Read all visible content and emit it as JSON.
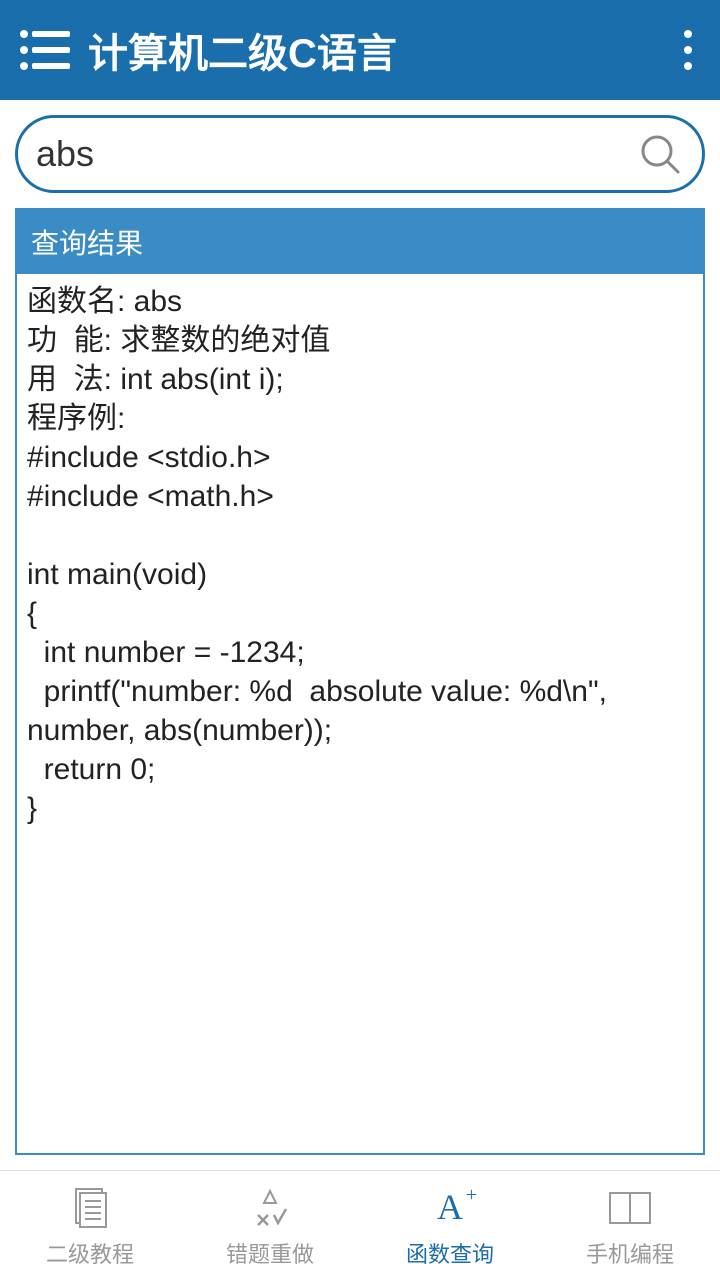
{
  "header": {
    "title": "计算机二级C语言"
  },
  "search": {
    "value": "abs",
    "placeholder": ""
  },
  "result": {
    "header": "查询结果",
    "body": "函数名: abs\n功  能: 求整数的绝对值\n用  法: int abs(int i);\n程序例:\n#include <stdio.h>\n#include <math.h>\n\nint main(void)\n{\n  int number = -1234;\n  printf(\"number: %d  absolute value: %d\\n\", number, abs(number));\n  return 0;\n}"
  },
  "nav": {
    "items": [
      {
        "label": "二级教程"
      },
      {
        "label": "错题重做"
      },
      {
        "label": "函数查询"
      },
      {
        "label": "手机编程"
      }
    ]
  }
}
